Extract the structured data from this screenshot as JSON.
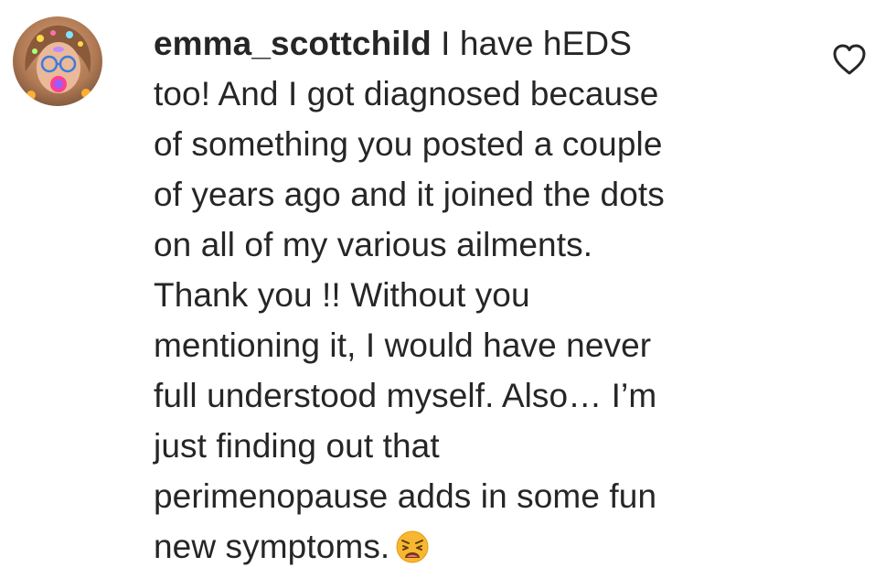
{
  "comment": {
    "username": "emma_scottchild",
    "lines": [
      " I have hEDS",
      "too! And I got diagnosed because",
      "of something you posted a couple",
      "of years ago and it joined the dots",
      "on all of my various ailments.",
      "Thank you !! Without you",
      "mentioning it, I would have never",
      "full understood myself. Also… I’m",
      "just finding out that",
      "perimenopause adds in some fun",
      "new symptoms."
    ],
    "trailing_emoji": "weary-face-emoji",
    "avatar_icon": "avatar",
    "like_icon": "heart-outline-icon"
  },
  "colors": {
    "text": "#262626",
    "background": "#ffffff",
    "emoji": "#f7b731"
  }
}
